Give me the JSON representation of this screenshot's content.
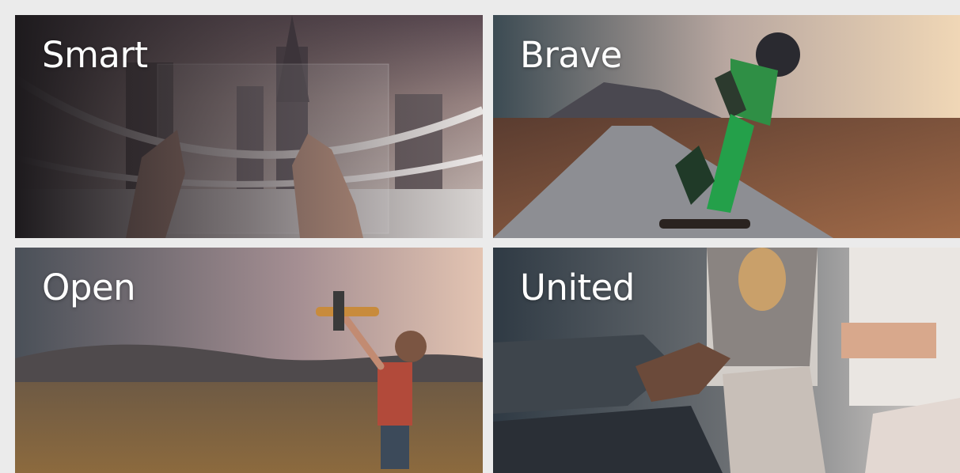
{
  "tiles": [
    {
      "label": "Smart"
    },
    {
      "label": "Brave"
    },
    {
      "label": "Open"
    },
    {
      "label": "United"
    }
  ]
}
